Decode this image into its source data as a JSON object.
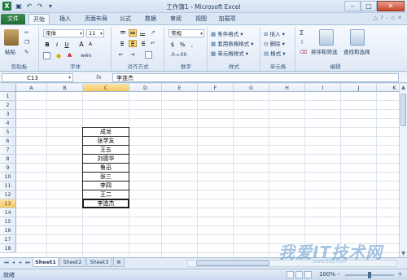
{
  "window": {
    "title": "工作簿1 - Microsoft Excel",
    "app_icon": "excel-icon",
    "controls": [
      "minimize",
      "maximize",
      "close"
    ]
  },
  "ribbon_tabs": {
    "file": "文件",
    "items": [
      "开始",
      "插入",
      "页面布局",
      "公式",
      "数据",
      "审阅",
      "视图",
      "加载项"
    ],
    "active": "开始"
  },
  "ribbon": {
    "clipboard": {
      "label": "剪贴板",
      "paste": "粘贴"
    },
    "font": {
      "label": "字体",
      "name": "宋体",
      "size": "11",
      "bold": "B",
      "italic": "I",
      "underline": "U",
      "grow": "A",
      "shrink": "A",
      "phonetic": "wén"
    },
    "alignment": {
      "label": "对齐方式"
    },
    "number": {
      "label": "数字",
      "format": "常规",
      "percent": "%",
      "comma": ",",
      "currency": "$"
    },
    "styles": {
      "label": "样式",
      "conditional": "条件格式",
      "table": "套用表格格式",
      "cell": "单元格样式"
    },
    "cells": {
      "label": "单元格",
      "insert": "插入",
      "delete": "删除",
      "format": "格式"
    },
    "editing": {
      "label": "编辑",
      "sum": "Σ",
      "sort": "排序和筛选",
      "find": "查找和选择"
    }
  },
  "formula_bar": {
    "name_box": "C13",
    "fx": "fx",
    "value": "李连杰"
  },
  "grid": {
    "columns": [
      "A",
      "B",
      "C",
      "D",
      "E",
      "F",
      "G",
      "H",
      "I",
      "J",
      "K"
    ],
    "rows": [
      "1",
      "2",
      "3",
      "4",
      "5",
      "6",
      "7",
      "8",
      "9",
      "10",
      "11",
      "12",
      "13",
      "14",
      "15",
      "16",
      "17",
      "18"
    ],
    "active_cell": "C13",
    "cells": [
      {
        "ref": "C5",
        "value": "成龙"
      },
      {
        "ref": "C6",
        "value": "张学友"
      },
      {
        "ref": "C7",
        "value": "王五"
      },
      {
        "ref": "C8",
        "value": "刘德华"
      },
      {
        "ref": "C9",
        "value": "鲁迅"
      },
      {
        "ref": "C10",
        "value": "张三"
      },
      {
        "ref": "C11",
        "value": "李四"
      },
      {
        "ref": "C12",
        "value": "王二"
      },
      {
        "ref": "C13",
        "value": "李连杰"
      }
    ]
  },
  "sheets": {
    "tabs": [
      "Sheet1",
      "Sheet2",
      "Sheet3"
    ],
    "active": "Sheet1"
  },
  "status": {
    "mode": "就绪",
    "zoom": "100%"
  },
  "watermark": {
    "text": "我爱IT技术网",
    "sub": "www.52ij.com"
  }
}
